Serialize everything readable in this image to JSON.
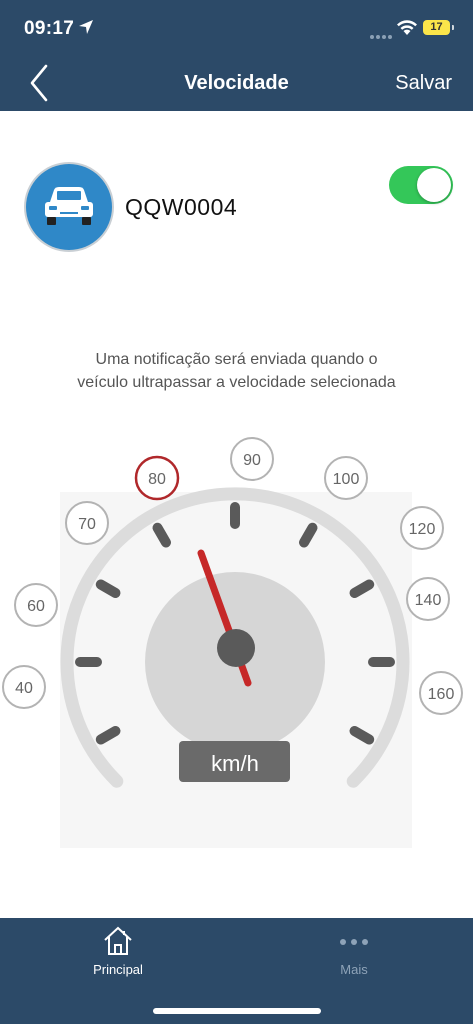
{
  "status_bar": {
    "time": "09:17",
    "battery": "17"
  },
  "nav": {
    "title": "Velocidade",
    "save_label": "Salvar"
  },
  "vehicle": {
    "plate": "QQW0004",
    "notifications_enabled": true
  },
  "notice": {
    "line1": "Uma notificação será enviada quando o",
    "line2": "veículo ultrapassar a velocidade selecionada"
  },
  "gauge": {
    "speed_options": [
      "40",
      "60",
      "70",
      "80",
      "90",
      "100",
      "120",
      "140",
      "160"
    ],
    "selected_speed": "80",
    "unit_label": "km/h"
  },
  "tabs": [
    {
      "label": "Principal",
      "icon": "home-icon",
      "active": true
    },
    {
      "label": "Mais",
      "icon": "more-dots-icon",
      "active": false
    }
  ],
  "colors": {
    "nav_background": "#2c4a68",
    "toggle_on": "#34c759",
    "avatar": "#2f88c8",
    "selected": "#b0282b",
    "needle": "#c62828"
  }
}
